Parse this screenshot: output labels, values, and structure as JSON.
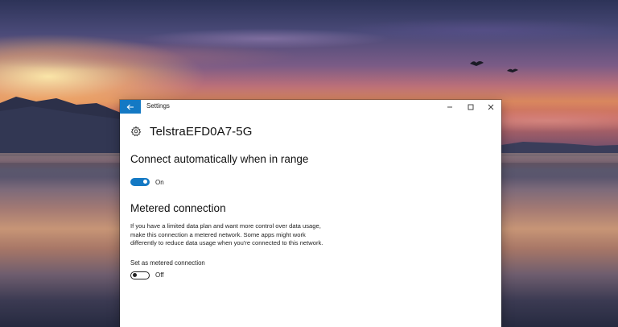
{
  "window": {
    "title": "Settings"
  },
  "network": {
    "name": "TelstraEFD0A7-5G"
  },
  "auto_connect": {
    "heading": "Connect automatically when in range",
    "toggle_state": "On",
    "enabled": true
  },
  "metered": {
    "heading": "Metered connection",
    "description": "If you have a limited data plan and want more control over data usage, make this connection a metered network. Some apps might work differently to reduce data usage when you're connected to this network.",
    "setting_label": "Set as metered connection",
    "toggle_state": "Off",
    "enabled": false
  },
  "colors": {
    "accent": "#1479c4",
    "window_bg": "#ffffff",
    "text": "#111111"
  },
  "icons": {
    "back": "arrow-left-icon",
    "minimize": "minimize-icon",
    "maximize": "maximize-icon",
    "close": "close-icon",
    "network": "gear-icon"
  }
}
